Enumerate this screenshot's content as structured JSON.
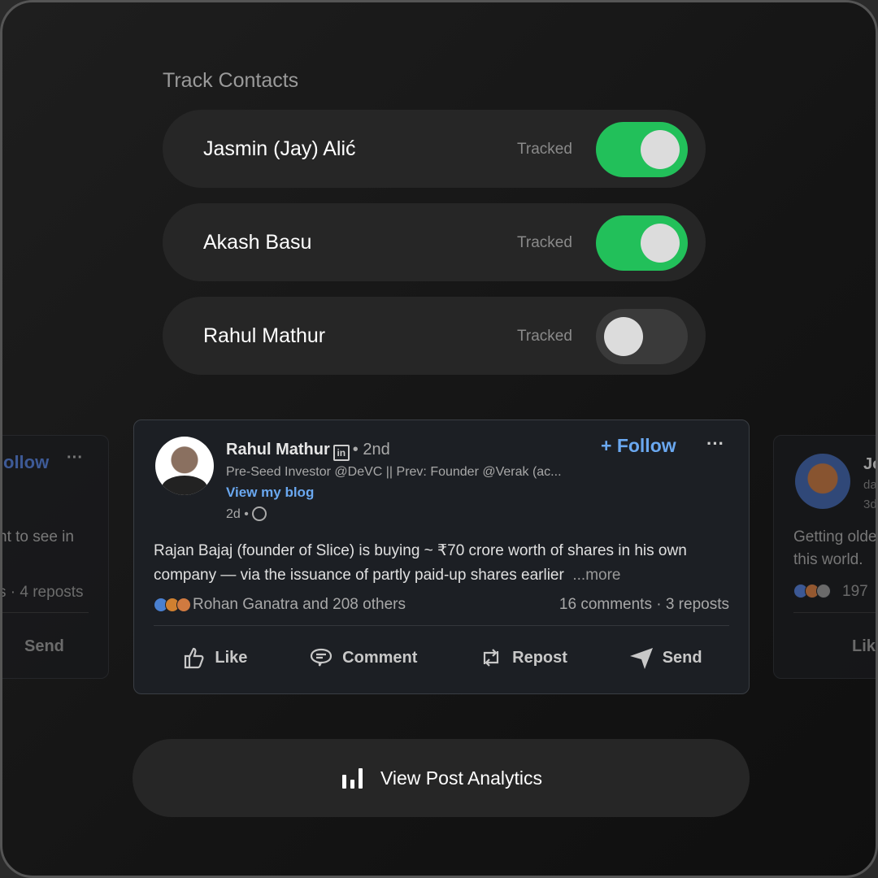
{
  "title": "Track Contacts",
  "contacts": [
    {
      "name": "Jasmin (Jay) Alić",
      "status": "Tracked",
      "on": true
    },
    {
      "name": "Akash Basu",
      "status": "Tracked",
      "on": true
    },
    {
      "name": "Rahul Mathur",
      "status": "Tracked",
      "on": false
    }
  ],
  "post": {
    "author": "Rahul Mathur",
    "degree": "• 2nd",
    "linkedin": "in",
    "headline": "Pre-Seed Investor @DeVC || Prev: Founder @Verak (ac...",
    "link": "View my blog",
    "time": "2d •",
    "follow": "+ Follow",
    "menu": "···",
    "text": "Rajan Bajaj (founder of Slice) is buying ~ ₹70 crore worth of shares in his own company — via the issuance of partly paid-up shares earlier",
    "more": "...more",
    "reactions": "Rohan Ganatra and 208 others",
    "stats": "16 comments · 3 reposts",
    "actions": {
      "like": "Like",
      "comment": "Comment",
      "repost": "Repost",
      "send": "Send"
    }
  },
  "left_card": {
    "follow": "ollow",
    "menu": "···",
    "text": "nt to see in",
    "stats": "s · 4 reposts",
    "send": "Send"
  },
  "right_card": {
    "author": "Jo",
    "sub": "dai",
    "time": "3d",
    "text1": "Getting olde",
    "text2": "this world.",
    "count": "197",
    "like": "Like"
  },
  "analytics_button": "View Post Analytics",
  "colors": {
    "toggle_on": "#22c05a",
    "link": "#6aa8f0"
  }
}
